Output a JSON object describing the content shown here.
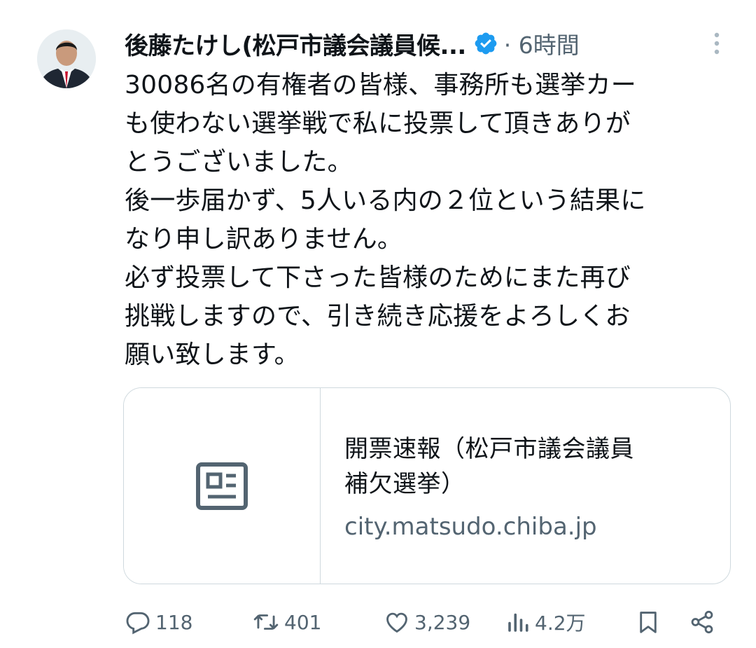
{
  "tweet": {
    "author_name": "後藤たけし(松戸市議会議員候...",
    "time": "· 6時間",
    "text_lines": [
      "30086名の有権者の皆様、事務所も選挙カー",
      "も使わない選挙戦で私に投票して頂きありが",
      "とうございました。",
      "後一歩届かず、5人いる内の２位という結果に",
      "なり申し訳ありません。",
      "必ず投票して下さった皆様のためにまた再び",
      "挑戦しますので、引き続き応援をよろしくお",
      "願い致します。"
    ]
  },
  "card": {
    "title_lines": [
      "開票速報（松戸市議会議員",
      "補欠選挙）"
    ],
    "domain": "city.matsudo.chiba.jp"
  },
  "actions": {
    "replies": "118",
    "retweets": "401",
    "likes": "3,239",
    "views": "4.2万"
  },
  "icons": [
    "verified-badge-icon",
    "more-options-icon",
    "article-icon",
    "reply-icon",
    "retweet-icon",
    "like-icon",
    "views-icon",
    "bookmark-icon",
    "share-icon"
  ],
  "colors": {
    "verified": "#1d9bf0",
    "secondary_text": "#536471",
    "border": "#cfd9de"
  }
}
